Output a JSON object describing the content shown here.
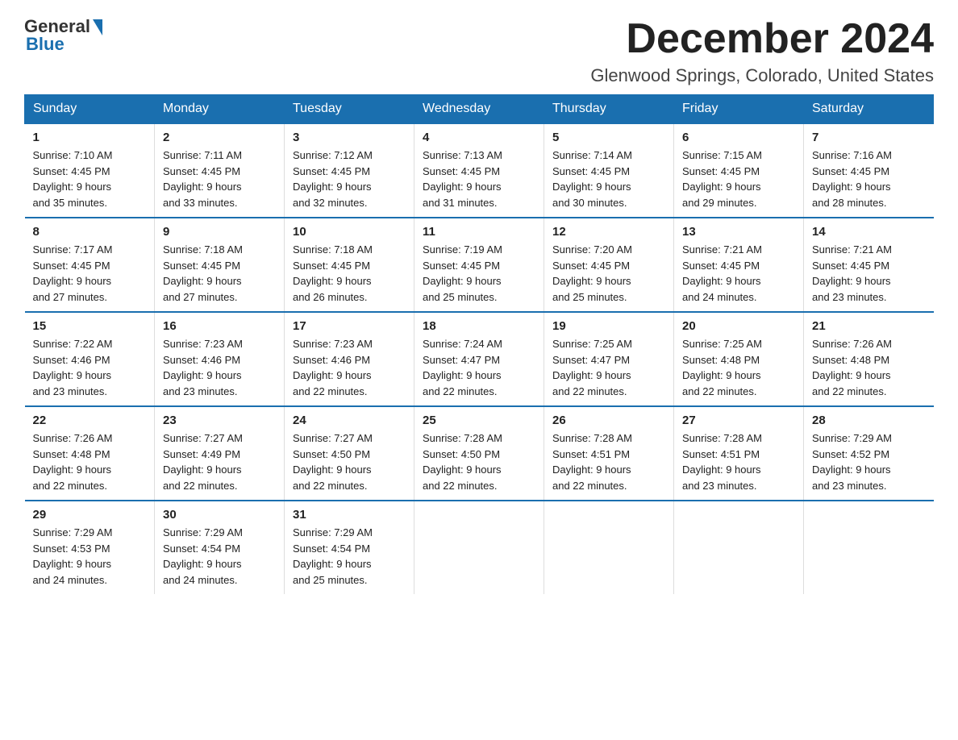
{
  "logo": {
    "general": "General",
    "blue": "Blue"
  },
  "title": {
    "month_year": "December 2024",
    "location": "Glenwood Springs, Colorado, United States"
  },
  "weekdays": [
    "Sunday",
    "Monday",
    "Tuesday",
    "Wednesday",
    "Thursday",
    "Friday",
    "Saturday"
  ],
  "weeks": [
    [
      {
        "day": "1",
        "sunrise": "7:10 AM",
        "sunset": "4:45 PM",
        "daylight": "9 hours and 35 minutes."
      },
      {
        "day": "2",
        "sunrise": "7:11 AM",
        "sunset": "4:45 PM",
        "daylight": "9 hours and 33 minutes."
      },
      {
        "day": "3",
        "sunrise": "7:12 AM",
        "sunset": "4:45 PM",
        "daylight": "9 hours and 32 minutes."
      },
      {
        "day": "4",
        "sunrise": "7:13 AM",
        "sunset": "4:45 PM",
        "daylight": "9 hours and 31 minutes."
      },
      {
        "day": "5",
        "sunrise": "7:14 AM",
        "sunset": "4:45 PM",
        "daylight": "9 hours and 30 minutes."
      },
      {
        "day": "6",
        "sunrise": "7:15 AM",
        "sunset": "4:45 PM",
        "daylight": "9 hours and 29 minutes."
      },
      {
        "day": "7",
        "sunrise": "7:16 AM",
        "sunset": "4:45 PM",
        "daylight": "9 hours and 28 minutes."
      }
    ],
    [
      {
        "day": "8",
        "sunrise": "7:17 AM",
        "sunset": "4:45 PM",
        "daylight": "9 hours and 27 minutes."
      },
      {
        "day": "9",
        "sunrise": "7:18 AM",
        "sunset": "4:45 PM",
        "daylight": "9 hours and 27 minutes."
      },
      {
        "day": "10",
        "sunrise": "7:18 AM",
        "sunset": "4:45 PM",
        "daylight": "9 hours and 26 minutes."
      },
      {
        "day": "11",
        "sunrise": "7:19 AM",
        "sunset": "4:45 PM",
        "daylight": "9 hours and 25 minutes."
      },
      {
        "day": "12",
        "sunrise": "7:20 AM",
        "sunset": "4:45 PM",
        "daylight": "9 hours and 25 minutes."
      },
      {
        "day": "13",
        "sunrise": "7:21 AM",
        "sunset": "4:45 PM",
        "daylight": "9 hours and 24 minutes."
      },
      {
        "day": "14",
        "sunrise": "7:21 AM",
        "sunset": "4:45 PM",
        "daylight": "9 hours and 23 minutes."
      }
    ],
    [
      {
        "day": "15",
        "sunrise": "7:22 AM",
        "sunset": "4:46 PM",
        "daylight": "9 hours and 23 minutes."
      },
      {
        "day": "16",
        "sunrise": "7:23 AM",
        "sunset": "4:46 PM",
        "daylight": "9 hours and 23 minutes."
      },
      {
        "day": "17",
        "sunrise": "7:23 AM",
        "sunset": "4:46 PM",
        "daylight": "9 hours and 22 minutes."
      },
      {
        "day": "18",
        "sunrise": "7:24 AM",
        "sunset": "4:47 PM",
        "daylight": "9 hours and 22 minutes."
      },
      {
        "day": "19",
        "sunrise": "7:25 AM",
        "sunset": "4:47 PM",
        "daylight": "9 hours and 22 minutes."
      },
      {
        "day": "20",
        "sunrise": "7:25 AM",
        "sunset": "4:48 PM",
        "daylight": "9 hours and 22 minutes."
      },
      {
        "day": "21",
        "sunrise": "7:26 AM",
        "sunset": "4:48 PM",
        "daylight": "9 hours and 22 minutes."
      }
    ],
    [
      {
        "day": "22",
        "sunrise": "7:26 AM",
        "sunset": "4:48 PM",
        "daylight": "9 hours and 22 minutes."
      },
      {
        "day": "23",
        "sunrise": "7:27 AM",
        "sunset": "4:49 PM",
        "daylight": "9 hours and 22 minutes."
      },
      {
        "day": "24",
        "sunrise": "7:27 AM",
        "sunset": "4:50 PM",
        "daylight": "9 hours and 22 minutes."
      },
      {
        "day": "25",
        "sunrise": "7:28 AM",
        "sunset": "4:50 PM",
        "daylight": "9 hours and 22 minutes."
      },
      {
        "day": "26",
        "sunrise": "7:28 AM",
        "sunset": "4:51 PM",
        "daylight": "9 hours and 22 minutes."
      },
      {
        "day": "27",
        "sunrise": "7:28 AM",
        "sunset": "4:51 PM",
        "daylight": "9 hours and 23 minutes."
      },
      {
        "day": "28",
        "sunrise": "7:29 AM",
        "sunset": "4:52 PM",
        "daylight": "9 hours and 23 minutes."
      }
    ],
    [
      {
        "day": "29",
        "sunrise": "7:29 AM",
        "sunset": "4:53 PM",
        "daylight": "9 hours and 24 minutes."
      },
      {
        "day": "30",
        "sunrise": "7:29 AM",
        "sunset": "4:54 PM",
        "daylight": "9 hours and 24 minutes."
      },
      {
        "day": "31",
        "sunrise": "7:29 AM",
        "sunset": "4:54 PM",
        "daylight": "9 hours and 25 minutes."
      },
      null,
      null,
      null,
      null
    ]
  ],
  "labels": {
    "sunrise": "Sunrise:",
    "sunset": "Sunset:",
    "daylight": "Daylight:"
  }
}
